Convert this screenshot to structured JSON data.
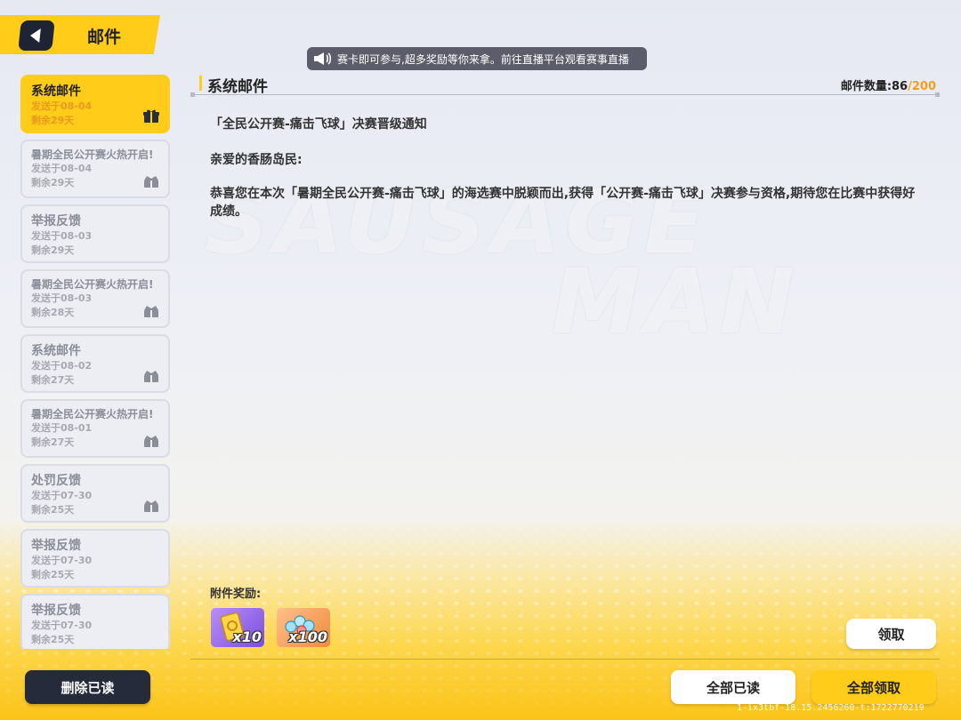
{
  "header": {
    "title": "邮件"
  },
  "marquee": {
    "text": "赛卡即可参与,超多奖励等你来拿。前往直播平台观看赛事直播"
  },
  "mail_list": [
    {
      "title": "系统邮件",
      "sent": "发送于08-04",
      "remaining": "剩余29天",
      "icon": "gift-icon",
      "active": true
    },
    {
      "title": "暑期全民公开赛火热开启!",
      "sent": "发送于08-04",
      "remaining": "剩余29天",
      "icon": "claimed-gift-icon",
      "active": false
    },
    {
      "title": "举报反馈",
      "sent": "发送于08-03",
      "remaining": "剩余29天",
      "icon": "",
      "active": false
    },
    {
      "title": "暑期全民公开赛火热开启!",
      "sent": "发送于08-03",
      "remaining": "剩余28天",
      "icon": "claimed-gift-icon",
      "active": false
    },
    {
      "title": "系统邮件",
      "sent": "发送于08-02",
      "remaining": "剩余27天",
      "icon": "claimed-gift-icon",
      "active": false
    },
    {
      "title": "暑期全民公开赛火热开启!",
      "sent": "发送于08-01",
      "remaining": "剩余27天",
      "icon": "claimed-gift-icon",
      "active": false
    },
    {
      "title": "处罚反馈",
      "sent": "发送于07-30",
      "remaining": "剩余25天",
      "icon": "claimed-gift-icon",
      "active": false
    },
    {
      "title": "举报反馈",
      "sent": "发送于07-30",
      "remaining": "剩余25天",
      "icon": "",
      "active": false
    },
    {
      "title": "举报反馈",
      "sent": "发送于07-30",
      "remaining": "剩余25天",
      "icon": "",
      "active": false
    }
  ],
  "mail": {
    "heading": "系统邮件",
    "count_label": "邮件数量:",
    "count_current": "86",
    "count_max": "/200",
    "subject": "「全民公开赛-痛击飞球」决赛晋级通知",
    "greeting": "亲爱的香肠岛民:",
    "body": "恭喜您在本次「暑期全民公开赛-痛击飞球」的海选赛中脱颖而出,获得「公开赛-痛击飞球」决赛参与资格,期待您在比赛中获得好成绩。",
    "attachments_label": "附件奖励:",
    "attachments": [
      {
        "icon": "ticket-card-icon",
        "qty": "x10"
      },
      {
        "icon": "coin-pile-icon",
        "qty": "x100"
      }
    ],
    "claim_label": "领取"
  },
  "footer": {
    "delete_read_label": "删除已读",
    "read_all_label": "全部已读",
    "claim_all_label": "全部领取",
    "build_id": "1-ix3tbf-18.15.2456260-t:1722770219"
  },
  "colors": {
    "accent": "#ffcc1a",
    "dark": "#252b3b",
    "count_max": "#f0a020"
  }
}
